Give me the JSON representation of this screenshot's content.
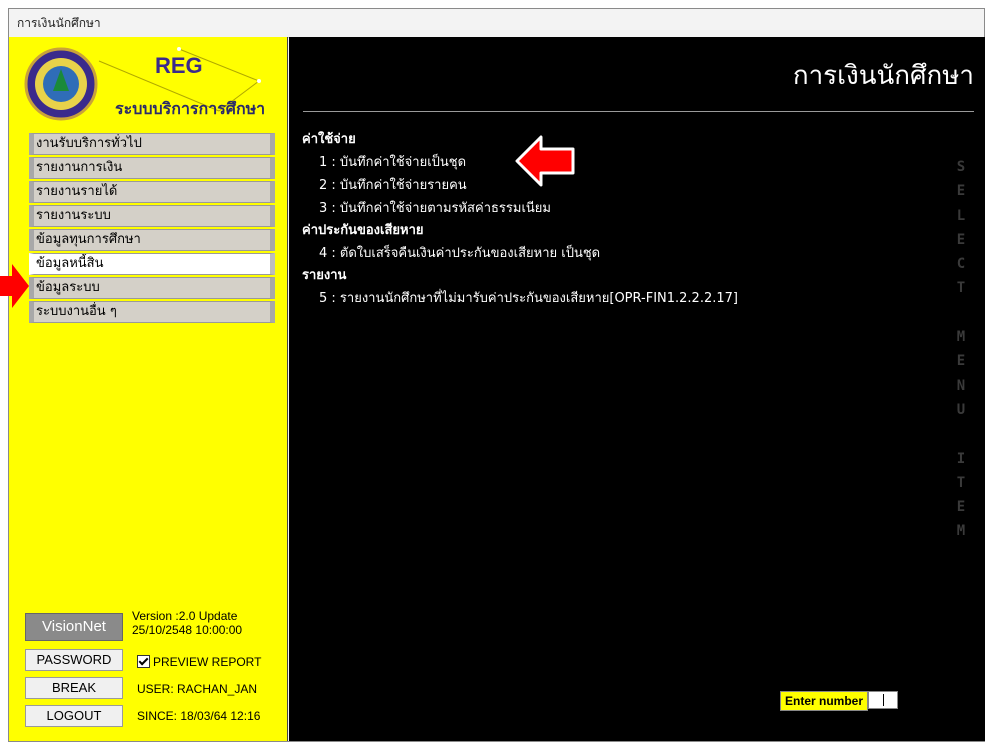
{
  "window": {
    "title": "การเงินนักศึกษา"
  },
  "logo": {
    "reg": "REG",
    "subtitle": "ระบบบริการการศึกษา"
  },
  "sidebar": {
    "items": [
      {
        "label": "งานรับบริการทั่วไป"
      },
      {
        "label": "รายงานการเงิน"
      },
      {
        "label": "รายงานรายได้"
      },
      {
        "label": "รายงานระบบ"
      },
      {
        "label": "ข้อมูลทุนการศึกษา"
      },
      {
        "label": "ข้อมูลหนี้สิน"
      },
      {
        "label": "ข้อมูลระบบ"
      },
      {
        "label": "ระบบงานอื่น ๆ"
      }
    ]
  },
  "footer": {
    "brand": "VisionNet",
    "version_line1": "Version :2.0 Update",
    "version_line2": "25/10/2548 10:00:00",
    "password_button": "PASSWORD",
    "break_button": "BREAK",
    "logout_button": "LOGOUT",
    "preview_report": "PREVIEW REPORT",
    "preview_checked": true,
    "user": "USER: RACHAN_JAN",
    "since": "SINCE: 18/03/64 12:16"
  },
  "main": {
    "title": "การเงินนักศึกษา",
    "sections": [
      {
        "title": "ค่าใช้จ่าย",
        "items": [
          "1 : บันทึกค่าใช้จ่ายเป็นชุด",
          "2 : บันทึกค่าใช้จ่ายรายคน",
          "3 : บันทึกค่าใช้จ่ายตามรหัสค่าธรรมเนียม"
        ]
      },
      {
        "title": "ค่าประกันของเสียหาย",
        "items": [
          "4 : ตัดใบเสร็จคืนเงินค่าประกันของเสียหาย เป็นชุด"
        ]
      },
      {
        "title": "รายงาน",
        "items": [
          "5 : รายงานนักศึกษาที่ไม่มารับค่าประกันของเสียหาย[OPR-FIN1.2.2.2.17]"
        ]
      }
    ],
    "side_letters": "SELECT MENU ITEM",
    "enter_number_label": "Enter number"
  },
  "colors": {
    "sidebar_bg": "#ffff00",
    "main_bg": "#000000",
    "arrow": "#ff0000"
  },
  "annotations": {
    "arrows": [
      "arrow-to-menu-item-1",
      "arrow-to-sidebar-debt"
    ]
  }
}
